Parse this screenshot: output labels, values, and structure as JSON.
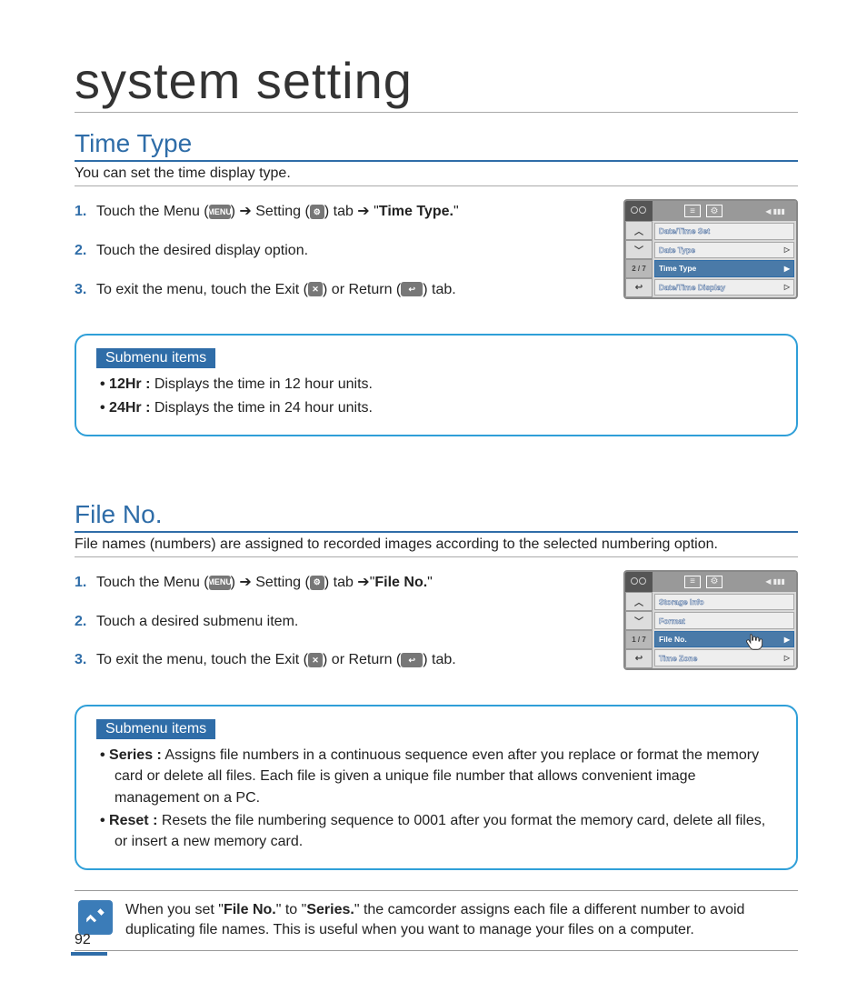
{
  "pageTitle": "system setting",
  "pageNumber": "92",
  "sections": [
    {
      "title": "Time Type",
      "intro": "You can set the time display type.",
      "steps": [
        {
          "pre": "Touch the Menu (",
          "icon1": "MENU",
          "mid1": ") ➔ Setting (",
          "icon2": "⚙",
          "mid2": ") tab ➔ \"",
          "bold": "Time Type.",
          "post": "\""
        },
        {
          "text": "Touch the desired display option."
        },
        {
          "pre": "To exit the menu, touch the Exit (",
          "icon1": "✕",
          "mid1": ") or Return (",
          "icon2": "↩",
          "post": ") tab."
        }
      ],
      "screen": {
        "page": "2 / 7",
        "rows": [
          {
            "label": "Date/Time Set",
            "selected": false,
            "right": ""
          },
          {
            "label": "Date Type",
            "selected": false,
            "right": "▷"
          },
          {
            "label": "Time Type",
            "selected": true,
            "right": "▶"
          },
          {
            "label": "Date/Time Display",
            "selected": false,
            "right": "▷"
          }
        ]
      },
      "submenu": {
        "label": "Submenu items",
        "items": [
          {
            "bold": "12Hr :",
            "text": " Displays the time in 12 hour units."
          },
          {
            "bold": "24Hr :",
            "text": " Displays the time in 24 hour units."
          }
        ]
      }
    },
    {
      "title": "File No.",
      "intro": "File names (numbers) are assigned to recorded images according to the selected numbering option.",
      "steps": [
        {
          "pre": "Touch the Menu (",
          "icon1": "MENU",
          "mid1": ") ➔ Setting (",
          "icon2": "⚙",
          "mid2": ") tab ➔\"",
          "bold": "File No.",
          "post": "\""
        },
        {
          "text": "Touch a desired submenu item."
        },
        {
          "pre": "To exit the menu, touch the Exit (",
          "icon1": "✕",
          "mid1": ") or Return (",
          "icon2": "↩",
          "post": ") tab."
        }
      ],
      "screen": {
        "page": "1 / 7",
        "rows": [
          {
            "label": "Storage Info",
            "selected": false,
            "right": ""
          },
          {
            "label": "Format",
            "selected": false,
            "right": ""
          },
          {
            "label": "File No.",
            "selected": true,
            "right": "▶"
          },
          {
            "label": "Time Zone",
            "selected": false,
            "right": "▷"
          }
        ]
      },
      "submenu": {
        "label": "Submenu items",
        "items": [
          {
            "bold": "Series :",
            "text": " Assigns file numbers in a continuous sequence even after you replace or format the memory card or delete all files. Each file is given a unique file number that allows convenient image management on a PC."
          },
          {
            "bold": "Reset :",
            "text": " Resets the file numbering sequence to 0001 after you format the memory card, delete all files, or insert a new memory card."
          }
        ]
      }
    }
  ],
  "note": {
    "pre": "When you set \"",
    "b1": "File No.",
    "mid": "\" to \"",
    "b2": "Series.",
    "post": "\" the camcorder assigns each file a different number to avoid duplicating file names. This is useful when you want to manage your files on a computer."
  }
}
